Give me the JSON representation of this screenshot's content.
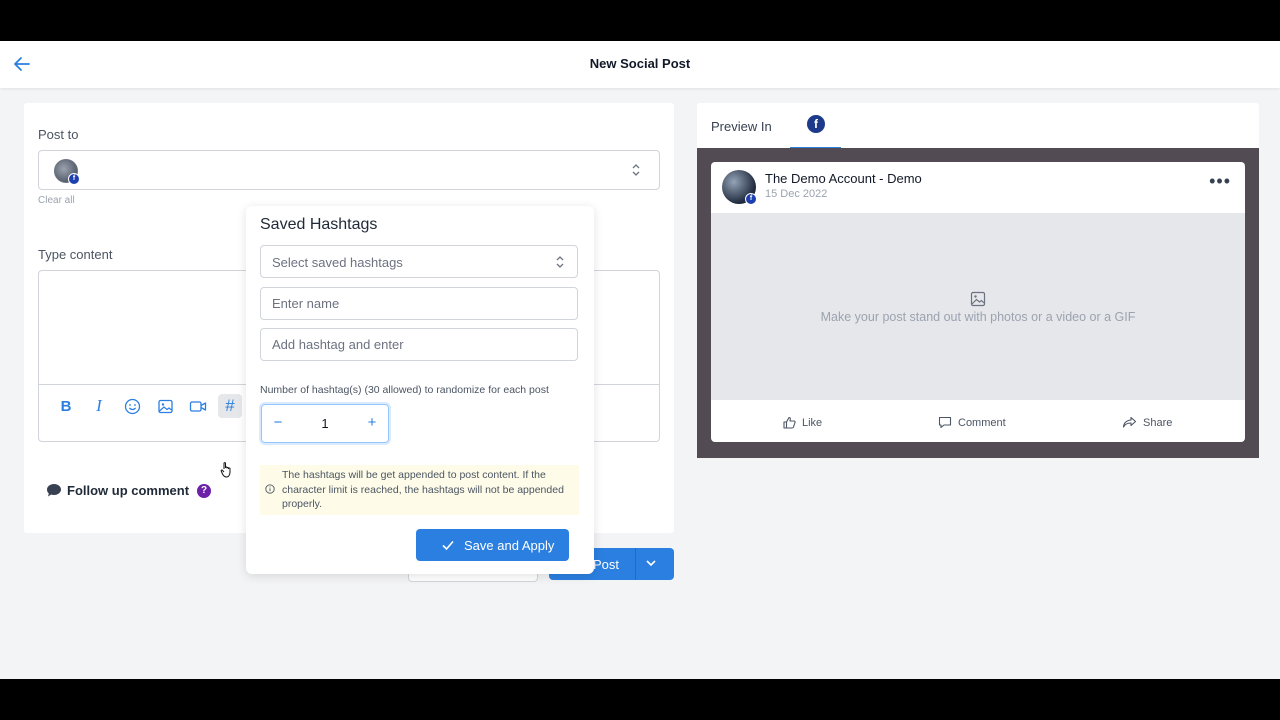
{
  "header": {
    "title": "New Social Post"
  },
  "composer": {
    "post_to_label": "Post to",
    "clear_all": "Clear all",
    "type_content_label": "Type content",
    "follow_up_label": "Follow up comment",
    "help_glyph": "?",
    "post_button_label": "Post"
  },
  "toolbar": {
    "items": [
      {
        "name": "bold",
        "glyph": "B"
      },
      {
        "name": "italic",
        "glyph": "I"
      },
      {
        "name": "emoji-icon"
      },
      {
        "name": "image-icon"
      },
      {
        "name": "video-icon"
      },
      {
        "name": "hashtag",
        "glyph": "#",
        "active": true
      }
    ]
  },
  "preview": {
    "label": "Preview In",
    "network_glyph": "f",
    "account_name": "The Demo Account - Demo",
    "date": "15 Dec 2022",
    "media_hint": "Make your post stand out with photos or a video or a GIF",
    "actions": {
      "like": "Like",
      "comment": "Comment",
      "share": "Share"
    }
  },
  "hashtags_popup": {
    "title": "Saved Hashtags",
    "select_placeholder": "Select saved hashtags",
    "name_placeholder": "Enter name",
    "hashtag_placeholder": "Add hashtag and enter",
    "count_label": "Number of hashtag(s) (30 allowed) to randomize for each post",
    "count_value": "1",
    "minus": "−",
    "plus": "+",
    "notice": "The hashtags will be get appended to post content. If the character limit is reached, the hashtags will not be appended properly.",
    "apply_label": "Save and Apply"
  },
  "colors": {
    "accent": "#2b7fe0",
    "facebook": "#1e3a8a",
    "help_badge": "#6b21a8",
    "notice_bg": "#fefce8"
  }
}
